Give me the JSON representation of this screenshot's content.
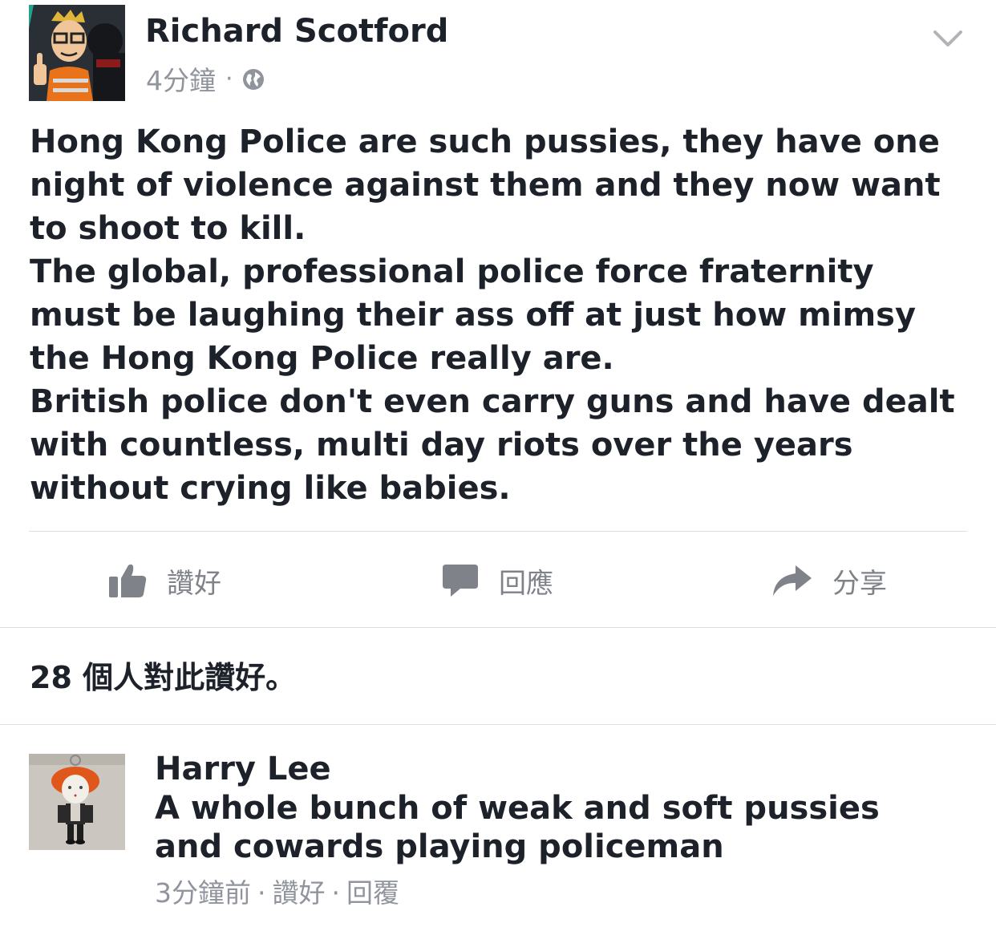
{
  "post": {
    "author": "Richard Scotford",
    "timestamp": "4分鐘",
    "meta_separator": "·",
    "privacy_icon": "globe-icon",
    "menu_icon": "chevron-down-icon",
    "paragraphs": [
      "Hong Kong Police are such pussies, they have one night of violence against them and they now want to shoot to kill.",
      "The global, professional police force fraternity must be laughing their ass off at just how mimsy the Hong Kong Police really are.",
      "British police don't even carry guns and have dealt with countless, multi day riots over the years without crying like babies."
    ]
  },
  "actions": {
    "like_label": "讚好",
    "comment_label": "回應",
    "share_label": "分享"
  },
  "likes": {
    "summary": "28 個人對此讚好。"
  },
  "comment": {
    "author": "Harry Lee",
    "text": "A whole bunch of weak and soft pussies and cowards playing policeman",
    "time": "3分鐘前",
    "like_label": "讚好",
    "reply_label": "回覆",
    "separator": "·"
  },
  "colors": {
    "text_primary": "#1d2129",
    "text_secondary": "#90949c",
    "icon_gray": "#7f8389",
    "divider": "#dddfe2"
  }
}
